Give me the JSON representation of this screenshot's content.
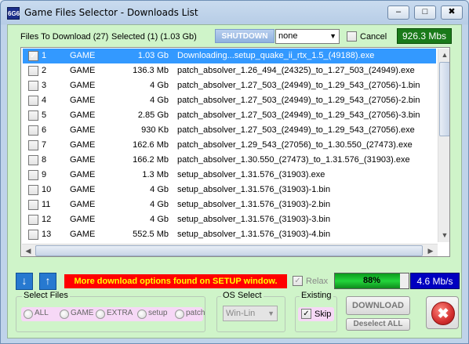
{
  "window": {
    "title": "Game Files Selector - Downloads List",
    "app_icon_text": "6G6",
    "minimize": "–",
    "maximize": "□",
    "close": "✖"
  },
  "topbar": {
    "files_to_download": "Files To Download (27)",
    "selected": "Selected  (1)  (1.03 Gb)",
    "shutdown_label": "SHUTDOWN",
    "shutdown_select_value": "none",
    "cancel_label": "Cancel",
    "total_speed": "926.3 Mbs"
  },
  "list": {
    "rows": [
      {
        "num": "1",
        "type": "GAME",
        "size": "1.03 Gb",
        "name": "Downloading...setup_quake_ii_rtx_1.5_(49188).exe",
        "checked": true,
        "selected": true
      },
      {
        "num": "2",
        "type": "GAME",
        "size": "136.3 Mb",
        "name": "patch_absolver_1.26_494_(24325)_to_1.27_503_(24949).exe",
        "checked": false,
        "selected": false
      },
      {
        "num": "3",
        "type": "GAME",
        "size": "4 Gb",
        "name": "patch_absolver_1.27_503_(24949)_to_1.29_543_(27056)-1.bin",
        "checked": false,
        "selected": false
      },
      {
        "num": "4",
        "type": "GAME",
        "size": "4 Gb",
        "name": "patch_absolver_1.27_503_(24949)_to_1.29_543_(27056)-2.bin",
        "checked": false,
        "selected": false
      },
      {
        "num": "5",
        "type": "GAME",
        "size": "2.85 Gb",
        "name": "patch_absolver_1.27_503_(24949)_to_1.29_543_(27056)-3.bin",
        "checked": false,
        "selected": false
      },
      {
        "num": "6",
        "type": "GAME",
        "size": "930 Kb",
        "name": "patch_absolver_1.27_503_(24949)_to_1.29_543_(27056).exe",
        "checked": false,
        "selected": false
      },
      {
        "num": "7",
        "type": "GAME",
        "size": "162.6 Mb",
        "name": "patch_absolver_1.29_543_(27056)_to_1.30.550_(27473).exe",
        "checked": false,
        "selected": false
      },
      {
        "num": "8",
        "type": "GAME",
        "size": "166.2 Mb",
        "name": "patch_absolver_1.30.550_(27473)_to_1.31.576_(31903).exe",
        "checked": false,
        "selected": false
      },
      {
        "num": "9",
        "type": "GAME",
        "size": "1.3 Mb",
        "name": "setup_absolver_1.31.576_(31903).exe",
        "checked": false,
        "selected": false
      },
      {
        "num": "10",
        "type": "GAME",
        "size": "4 Gb",
        "name": "setup_absolver_1.31.576_(31903)-1.bin",
        "checked": false,
        "selected": false
      },
      {
        "num": "11",
        "type": "GAME",
        "size": "4 Gb",
        "name": "setup_absolver_1.31.576_(31903)-2.bin",
        "checked": false,
        "selected": false
      },
      {
        "num": "12",
        "type": "GAME",
        "size": "4 Gb",
        "name": "setup_absolver_1.31.576_(31903)-3.bin",
        "checked": false,
        "selected": false
      },
      {
        "num": "13",
        "type": "GAME",
        "size": "552.5 Mb",
        "name": "setup_absolver_1.31.576_(31903)-4.bin",
        "checked": false,
        "selected": false
      }
    ]
  },
  "status": {
    "message": "More download options found on SETUP window.",
    "relax_label": "Relax",
    "progress_text": "88%",
    "progress_fraction": 0.88,
    "speed": "4.6 Mb/s"
  },
  "select_files": {
    "label": "Select Files",
    "options": [
      "ALL",
      "GAME",
      "EXTRA",
      "setup",
      "patch"
    ]
  },
  "os_select": {
    "label": "OS Select",
    "value": "Win-Lin"
  },
  "existing": {
    "label": "Existing",
    "skip_label": "Skip"
  },
  "buttons": {
    "download": "DOWNLOAD",
    "deselect_all": "Deselect ALL",
    "cancel_x": "✖"
  },
  "colors": {
    "client_bg": "#cff4c9",
    "selected_row": "#3399ff",
    "speed_green": "#1a7a1a",
    "speed_blue": "#0000c0",
    "message_bg": "#ff0000",
    "message_text": "#ffff00"
  }
}
